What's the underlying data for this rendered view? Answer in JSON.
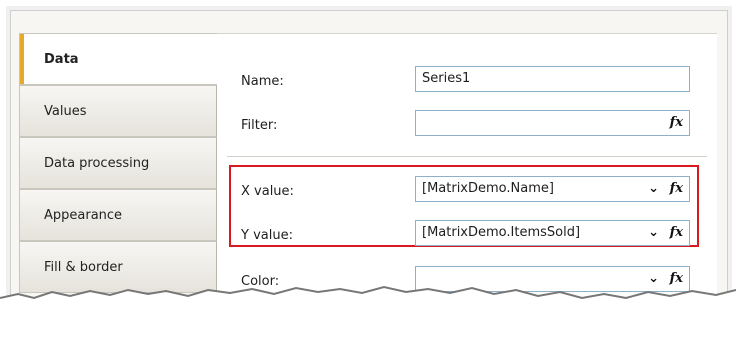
{
  "tabs": [
    {
      "label": "Data",
      "active": true
    },
    {
      "label": "Values",
      "active": false
    },
    {
      "label": "Data processing",
      "active": false
    },
    {
      "label": "Appearance",
      "active": false
    },
    {
      "label": "Fill & border",
      "active": false
    }
  ],
  "fields": {
    "name": {
      "label": "Name:",
      "value": "Series1"
    },
    "filter": {
      "label": "Filter:",
      "value": ""
    },
    "x_value": {
      "label": "X value:",
      "value": "[MatrixDemo.Name]"
    },
    "y_value": {
      "label": "Y value:",
      "value": "[MatrixDemo.ItemsSold]"
    },
    "color": {
      "label": "Color:",
      "value": ""
    }
  },
  "icons": {
    "expression": "fx",
    "dropdown": "chevron-down"
  },
  "highlight_color": "#d9181f",
  "accent_color": "#e8a82a"
}
